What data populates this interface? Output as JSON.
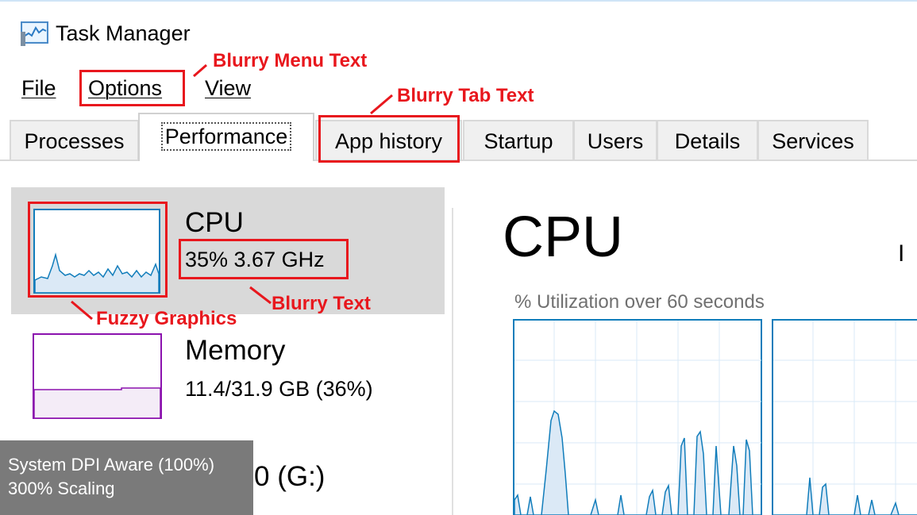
{
  "window": {
    "title": "Task Manager",
    "icon": "task-manager-icon"
  },
  "menu": {
    "items": [
      "File",
      "Options",
      "View"
    ]
  },
  "tabs": {
    "items": [
      "Processes",
      "Performance",
      "App history",
      "Startup",
      "Users",
      "Details",
      "Services"
    ],
    "active": "Performance"
  },
  "sidebar": {
    "cpu": {
      "label": "CPU",
      "value": "35% 3.67 GHz"
    },
    "memory": {
      "label": "Memory",
      "value": "11.4/31.9 GB (36%)"
    },
    "drive": {
      "label_tail": "0 (G:)"
    }
  },
  "main": {
    "title": "CPU",
    "partial_label": "I",
    "util_label": "% Utilization over 60 seconds"
  },
  "annotations": {
    "menu_text": "Blurry Menu Text",
    "tab_text": "Blurry Tab Text",
    "graphics": "Fuzzy Graphics",
    "text": "Blurry Text"
  },
  "overlay": {
    "line1": "System DPI Aware (100%)",
    "line2": "300% Scaling"
  },
  "colors": {
    "annotation": "#e8171d",
    "cpu_graph": "#117dbb",
    "memory_graph": "#8b12ae",
    "selected_bg": "#d9d9d9"
  }
}
